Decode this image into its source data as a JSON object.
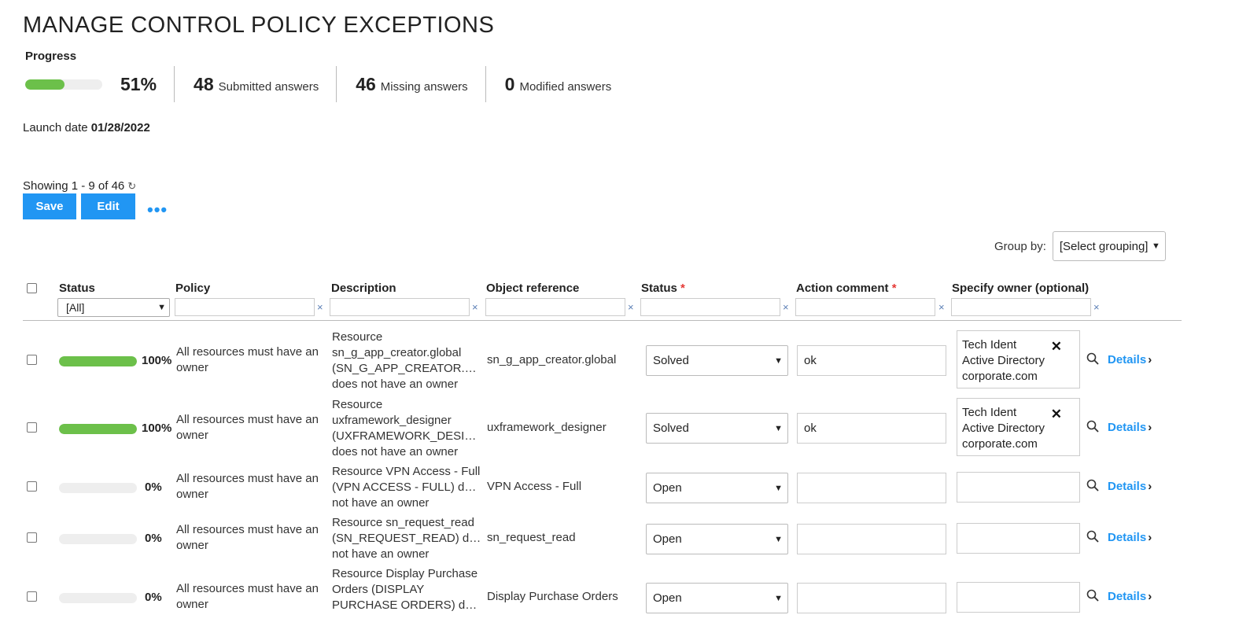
{
  "page": {
    "title": "MANAGE CONTROL POLICY EXCEPTIONS"
  },
  "progress": {
    "label": "Progress",
    "value": 0.51,
    "percent_text": "51%",
    "submitted_count": "48",
    "submitted_label": "Submitted answers",
    "missing_count": "46",
    "missing_label": "Missing answers",
    "modified_count": "0",
    "modified_label": "Modified answers"
  },
  "launch": {
    "label": "Launch date",
    "date": "01/28/2022"
  },
  "toolbar": {
    "showing": "Showing 1 - 9 of 46",
    "save_label": "Save",
    "edit_label": "Edit",
    "more_label": "•••"
  },
  "groupby": {
    "label": "Group by:",
    "selected": "[Select grouping]"
  },
  "table": {
    "headers": {
      "status": "Status",
      "policy": "Policy",
      "description": "Description",
      "object_reference": "Object reference",
      "answer_status": "Status",
      "action_comment": "Action comment",
      "owner": "Specify owner (optional)",
      "required_mark": "*"
    },
    "status_filter": "[All]",
    "clear_symbol": "×",
    "rows": [
      {
        "progress": 1.0,
        "pct": "100%",
        "policy": "All resources must have an owner",
        "description": [
          "Resource",
          "sn_g_app_creator.global",
          "(SN_G_APP_CREATOR.GL...",
          "does not have an owner"
        ],
        "object_ref": "sn_g_app_creator.global",
        "status": "Solved",
        "comment": "ok",
        "owner": [
          "Tech Ident",
          "Active Directory",
          "corporate.com"
        ],
        "details": "Details"
      },
      {
        "progress": 1.0,
        "pct": "100%",
        "policy": "All resources must have an owner",
        "description": [
          "Resource",
          "uxframework_designer",
          "(UXFRAMEWORK_DESIGN...",
          "does not have an owner"
        ],
        "object_ref": "uxframework_designer",
        "status": "Solved",
        "comment": "ok",
        "owner": [
          "Tech Ident",
          "Active Directory",
          "corporate.com"
        ],
        "details": "Details"
      },
      {
        "progress": 0.0,
        "pct": "0%",
        "policy": "All resources must have an owner",
        "description": [
          "Resource VPN Access - Full",
          "(VPN ACCESS - FULL) does",
          "not have an owner"
        ],
        "object_ref": "VPN Access - Full",
        "status": "Open",
        "comment": "",
        "owner": [],
        "details": "Details"
      },
      {
        "progress": 0.0,
        "pct": "0%",
        "policy": "All resources must have an owner",
        "description": [
          "Resource sn_request_read",
          "(SN_REQUEST_READ) does",
          "not have an owner"
        ],
        "object_ref": "sn_request_read",
        "status": "Open",
        "comment": "",
        "owner": [],
        "details": "Details"
      },
      {
        "progress": 0.0,
        "pct": "0%",
        "policy": "All resources must have an owner",
        "description": [
          "Resource Display Purchase",
          "Orders (DISPLAY",
          "PURCHASE ORDERS) does"
        ],
        "object_ref": "Display Purchase Orders",
        "status": "Open",
        "comment": "",
        "owner": [],
        "details": "Details"
      }
    ]
  },
  "icons": {
    "refresh": "refresh-icon",
    "search": "search-icon",
    "chevron": "chevron-right-icon",
    "caret": "chevron-down-icon",
    "remove": "close-icon"
  },
  "colors": {
    "accent": "#2196f3",
    "progress_fill": "#6cc04a",
    "required": "#e53935"
  }
}
